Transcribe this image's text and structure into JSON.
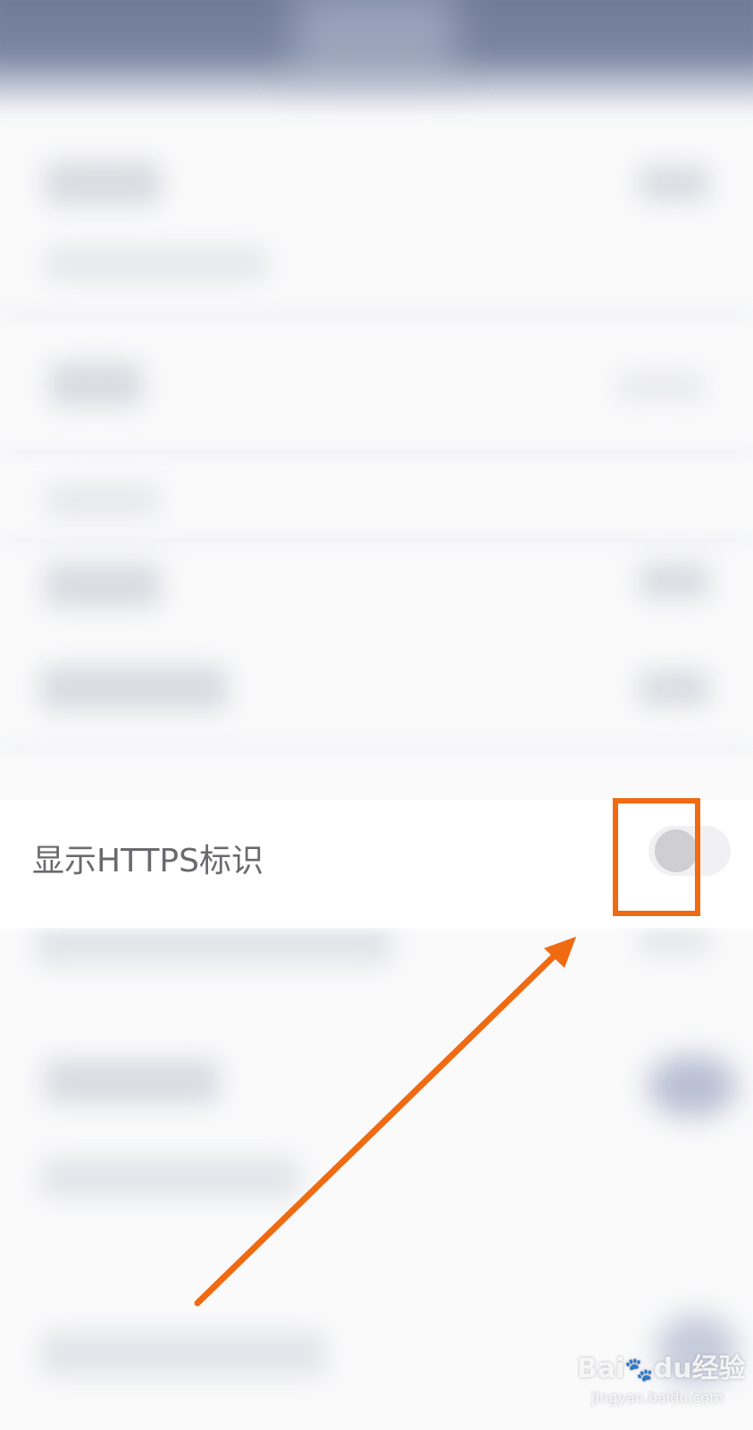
{
  "setting": {
    "label": "显示HTTPS标识",
    "enabled": false
  },
  "annotation": {
    "color": "#f06a11"
  },
  "watermark": {
    "brand": "Bai",
    "brand_suffix": "du",
    "product": "经验",
    "url": "jingyan.baidu.com"
  }
}
